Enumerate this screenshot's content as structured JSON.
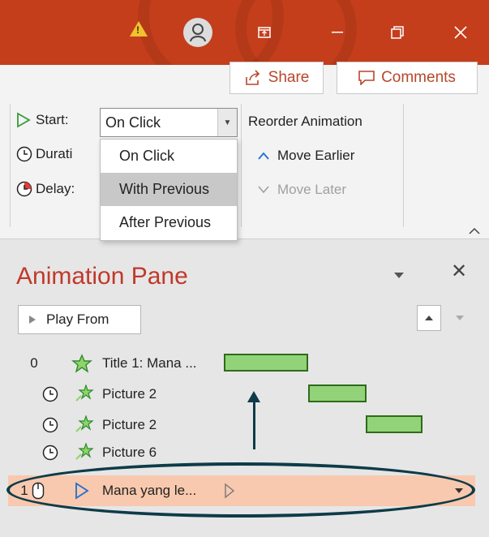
{
  "ribbon": {
    "share_label": "Share",
    "comments_label": "Comments",
    "start_label": "Start:",
    "start_value": "On Click",
    "duration_label": "Durati",
    "delay_label": "Delay:",
    "reorder_title": "Reorder Animation",
    "move_earlier": "Move Earlier",
    "move_later": "Move Later",
    "dropdown_options": [
      "On Click",
      "With Previous",
      "After Previous"
    ],
    "dropdown_selected": "With Previous"
  },
  "pane": {
    "title": "Animation Pane",
    "play_from": "Play From",
    "rows": [
      {
        "num": "0",
        "label": "Title 1: Mana ..."
      },
      {
        "num": "",
        "label": "Picture 2"
      },
      {
        "num": "",
        "label": "Picture 2"
      },
      {
        "num": "",
        "label": "Picture 6"
      },
      {
        "num": "1",
        "label": "Mana yang le..."
      }
    ]
  },
  "colors": {
    "title_bar": "#c43e1c",
    "accent": "#b7472a",
    "bar_fill": "#92d37a",
    "highlight_row": "#f8c9ae",
    "annotation": "#0e3b48"
  }
}
